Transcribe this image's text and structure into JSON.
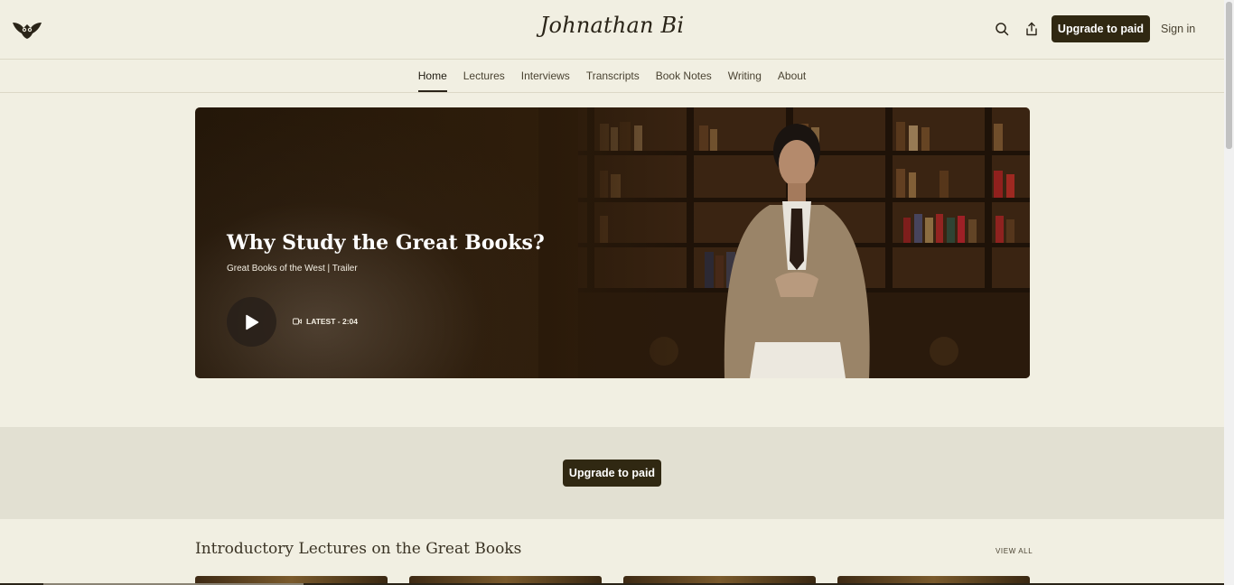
{
  "header": {
    "site_title": "Johnathan Bi",
    "logo_icon": "owl-icon",
    "search_icon": "search-icon",
    "share_icon": "share-icon",
    "upgrade_label": "Upgrade to paid",
    "signin_label": "Sign in"
  },
  "nav": {
    "items": [
      {
        "label": "Home",
        "active": true
      },
      {
        "label": "Lectures"
      },
      {
        "label": "Interviews"
      },
      {
        "label": "Transcripts"
      },
      {
        "label": "Book Notes"
      },
      {
        "label": "Writing"
      },
      {
        "label": "About"
      }
    ]
  },
  "hero": {
    "title": "Why Study the Great Books?",
    "subtitle": "Great Books of the West | Trailer",
    "meta": "LATEST - 2:04",
    "play_icon": "play-icon",
    "video_icon": "video-icon"
  },
  "band": {
    "upgrade_label": "Upgrade to paid"
  },
  "lectures": {
    "title": "Introductory Lectures on the Great Books",
    "view_all": "VIEW ALL"
  },
  "colors": {
    "background": "#f1efe2",
    "band": "#e2e0d2",
    "button": "#302812",
    "text": "#2a2418"
  }
}
